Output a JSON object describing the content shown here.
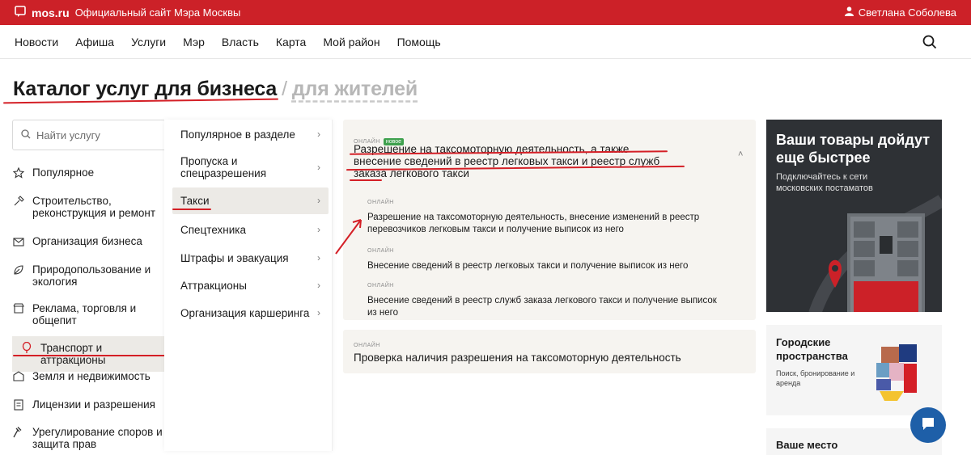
{
  "topbar": {
    "logo": "mos.ru",
    "site_label": "Официальный сайт Мэра Москвы",
    "user": "Светлана Соболева"
  },
  "nav": {
    "items": [
      "Новости",
      "Афиша",
      "Услуги",
      "Мэр",
      "Власть",
      "Карта",
      "Мой район",
      "Помощь"
    ]
  },
  "heading": {
    "business": "Каталог услуг для бизнеса",
    "sep": "/",
    "residents": "для жителей"
  },
  "search": {
    "placeholder": "Найти услугу"
  },
  "categories": [
    {
      "label": "Популярное"
    },
    {
      "label": "Строительство, реконструкция и ремонт"
    },
    {
      "label": "Организация бизнеса"
    },
    {
      "label": "Природопользование и экология"
    },
    {
      "label": "Реклама, торговля и общепит"
    },
    {
      "label": "Транспорт и аттракционы"
    },
    {
      "label": "Земля и недвижимость"
    },
    {
      "label": "Лицензии и разрешения"
    },
    {
      "label": "Урегулирование споров и защита прав"
    }
  ],
  "subcategories": [
    {
      "label": "Популярное в разделе"
    },
    {
      "label": "Пропуска и спецразрешения"
    },
    {
      "label": "Такси"
    },
    {
      "label": "Спецтехника"
    },
    {
      "label": "Штрафы и эвакуация"
    },
    {
      "label": "Аттракционы"
    },
    {
      "label": "Организация каршеринга"
    }
  ],
  "card1": {
    "tag": "онлайн",
    "badge": "новое",
    "title": "Разрешение на таксомоторную деятельность, а также внесение сведений в реестр легковых такси и реестр служб заказа легкового такси",
    "services": [
      {
        "tag": "онлайн",
        "text": "Разрешение на таксомоторную деятельность, внесение изменений в реестр перевозчиков легковым такси и получение выписок из него"
      },
      {
        "tag": "онлайн",
        "text": "Внесение сведений в реестр легковых такси и получение выписок из него"
      },
      {
        "tag": "онлайн",
        "text": "Внесение сведений в реестр служб заказа легкового такси и получение выписок из него"
      }
    ]
  },
  "card2": {
    "tag": "онлайн",
    "title": "Проверка наличия разрешения на таксомоторную деятельность"
  },
  "promo1": {
    "title": "Ваши товары дойдут еще быстрее",
    "text": "Подключайтесь к сети московских постаматов"
  },
  "promo2": {
    "title": "Городские пространства",
    "text": "Поиск, бронирование и аренда"
  },
  "promo3": {
    "title": "Ваше место"
  },
  "colors": {
    "brand": "#cc2128",
    "annotation": "#d41f26",
    "card_bg": "#f6f4f0",
    "promo_dark": "#2e3135",
    "chat": "#1e5fa8",
    "badge": "#3fa14e"
  }
}
